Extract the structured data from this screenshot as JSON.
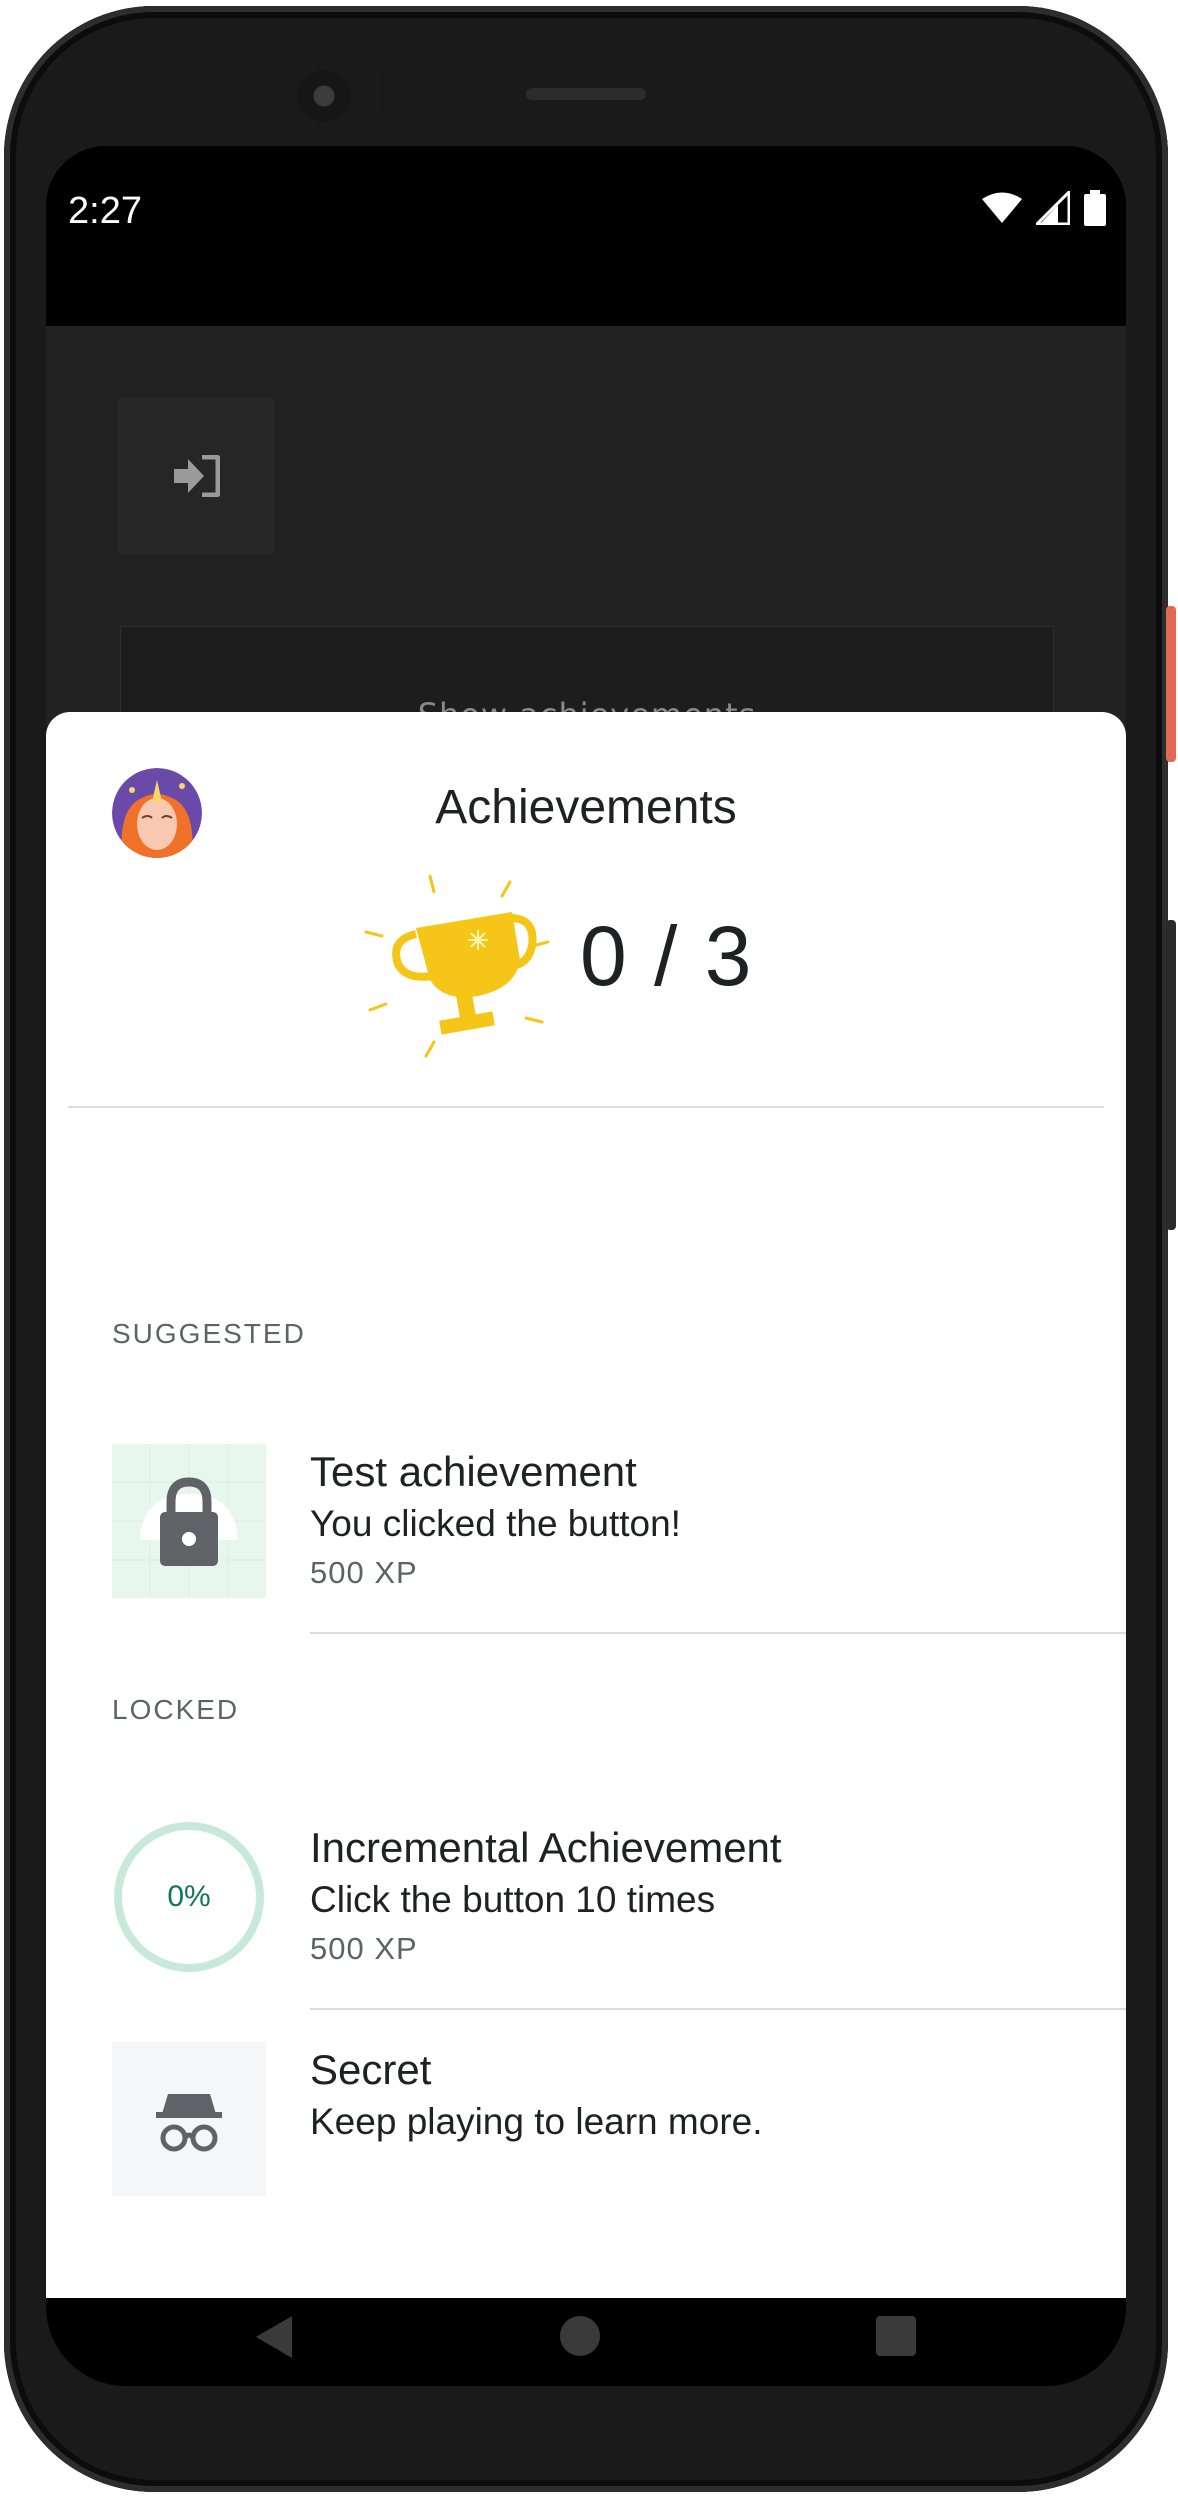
{
  "status_bar": {
    "time": "2:27"
  },
  "app": {
    "show_achievements_label": "Show achievements"
  },
  "sheet": {
    "title": "Achievements",
    "unlocked_count": "0 / 3",
    "sections": {
      "suggested": "SUGGESTED",
      "locked": "LOCKED"
    },
    "items": [
      {
        "name": "Test achievement",
        "description": "You clicked the button!",
        "xp": "500 XP",
        "icon": "lock-icon"
      },
      {
        "name": "Incremental Achievement",
        "description": "Click the button 10 times",
        "xp": "500 XP",
        "progress": "0%",
        "progress_fraction": 0,
        "icon": "progress-ring"
      },
      {
        "name": "Secret",
        "description": "Keep playing to learn more.",
        "icon": "incognito-icon"
      }
    ]
  },
  "colors": {
    "trophy": "#f5c518",
    "progress_ring": "#c6e9dc",
    "progress_text": "#0d7a55",
    "suggested_tile": "#e8f7ee"
  }
}
